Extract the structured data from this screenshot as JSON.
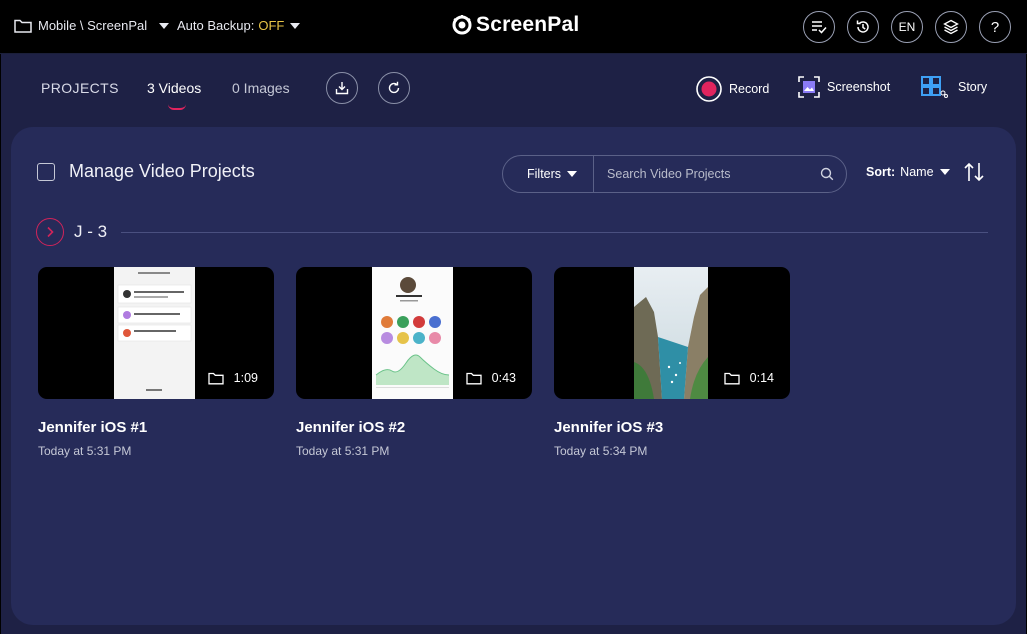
{
  "topbar": {
    "breadcrumb": "Mobile \\ ScreenPal",
    "backup_label": "Auto Backup:",
    "backup_value": "OFF",
    "logo_text": "ScreenPal",
    "language": "EN",
    "help_label": "?",
    "icons": [
      "folder-icon",
      "checklist-icon",
      "history-icon",
      "layers-icon",
      "help-icon"
    ]
  },
  "nav": {
    "projects_label": "PROJECTS",
    "tabs": [
      {
        "label": "3 Videos",
        "active": true
      },
      {
        "label": "0 Images",
        "active": false
      }
    ],
    "actions": {
      "record": "Record",
      "screenshot": "Screenshot",
      "story": "Story"
    }
  },
  "toolbar": {
    "manage_label": "Manage Video Projects",
    "filters_label": "Filters",
    "search_placeholder": "Search Video Projects",
    "sort_label": "Sort:",
    "sort_value": "Name"
  },
  "group": {
    "label": "J - 3"
  },
  "videos": [
    {
      "title": "Jennifer iOS #1",
      "date": "Today at 5:31 PM",
      "duration": "1:09"
    },
    {
      "title": "Jennifer iOS #2",
      "date": "Today at 5:31 PM",
      "duration": "0:43"
    },
    {
      "title": "Jennifer iOS #3",
      "date": "Today at 5:34 PM",
      "duration": "0:14"
    }
  ],
  "colors": {
    "accent": "#e0245e",
    "backup_off": "#e8c547",
    "panel": "#262b59",
    "background": "#1e2145",
    "story_icon": "#3ea0f5",
    "screenshot_icon": "#8b7cf6"
  }
}
